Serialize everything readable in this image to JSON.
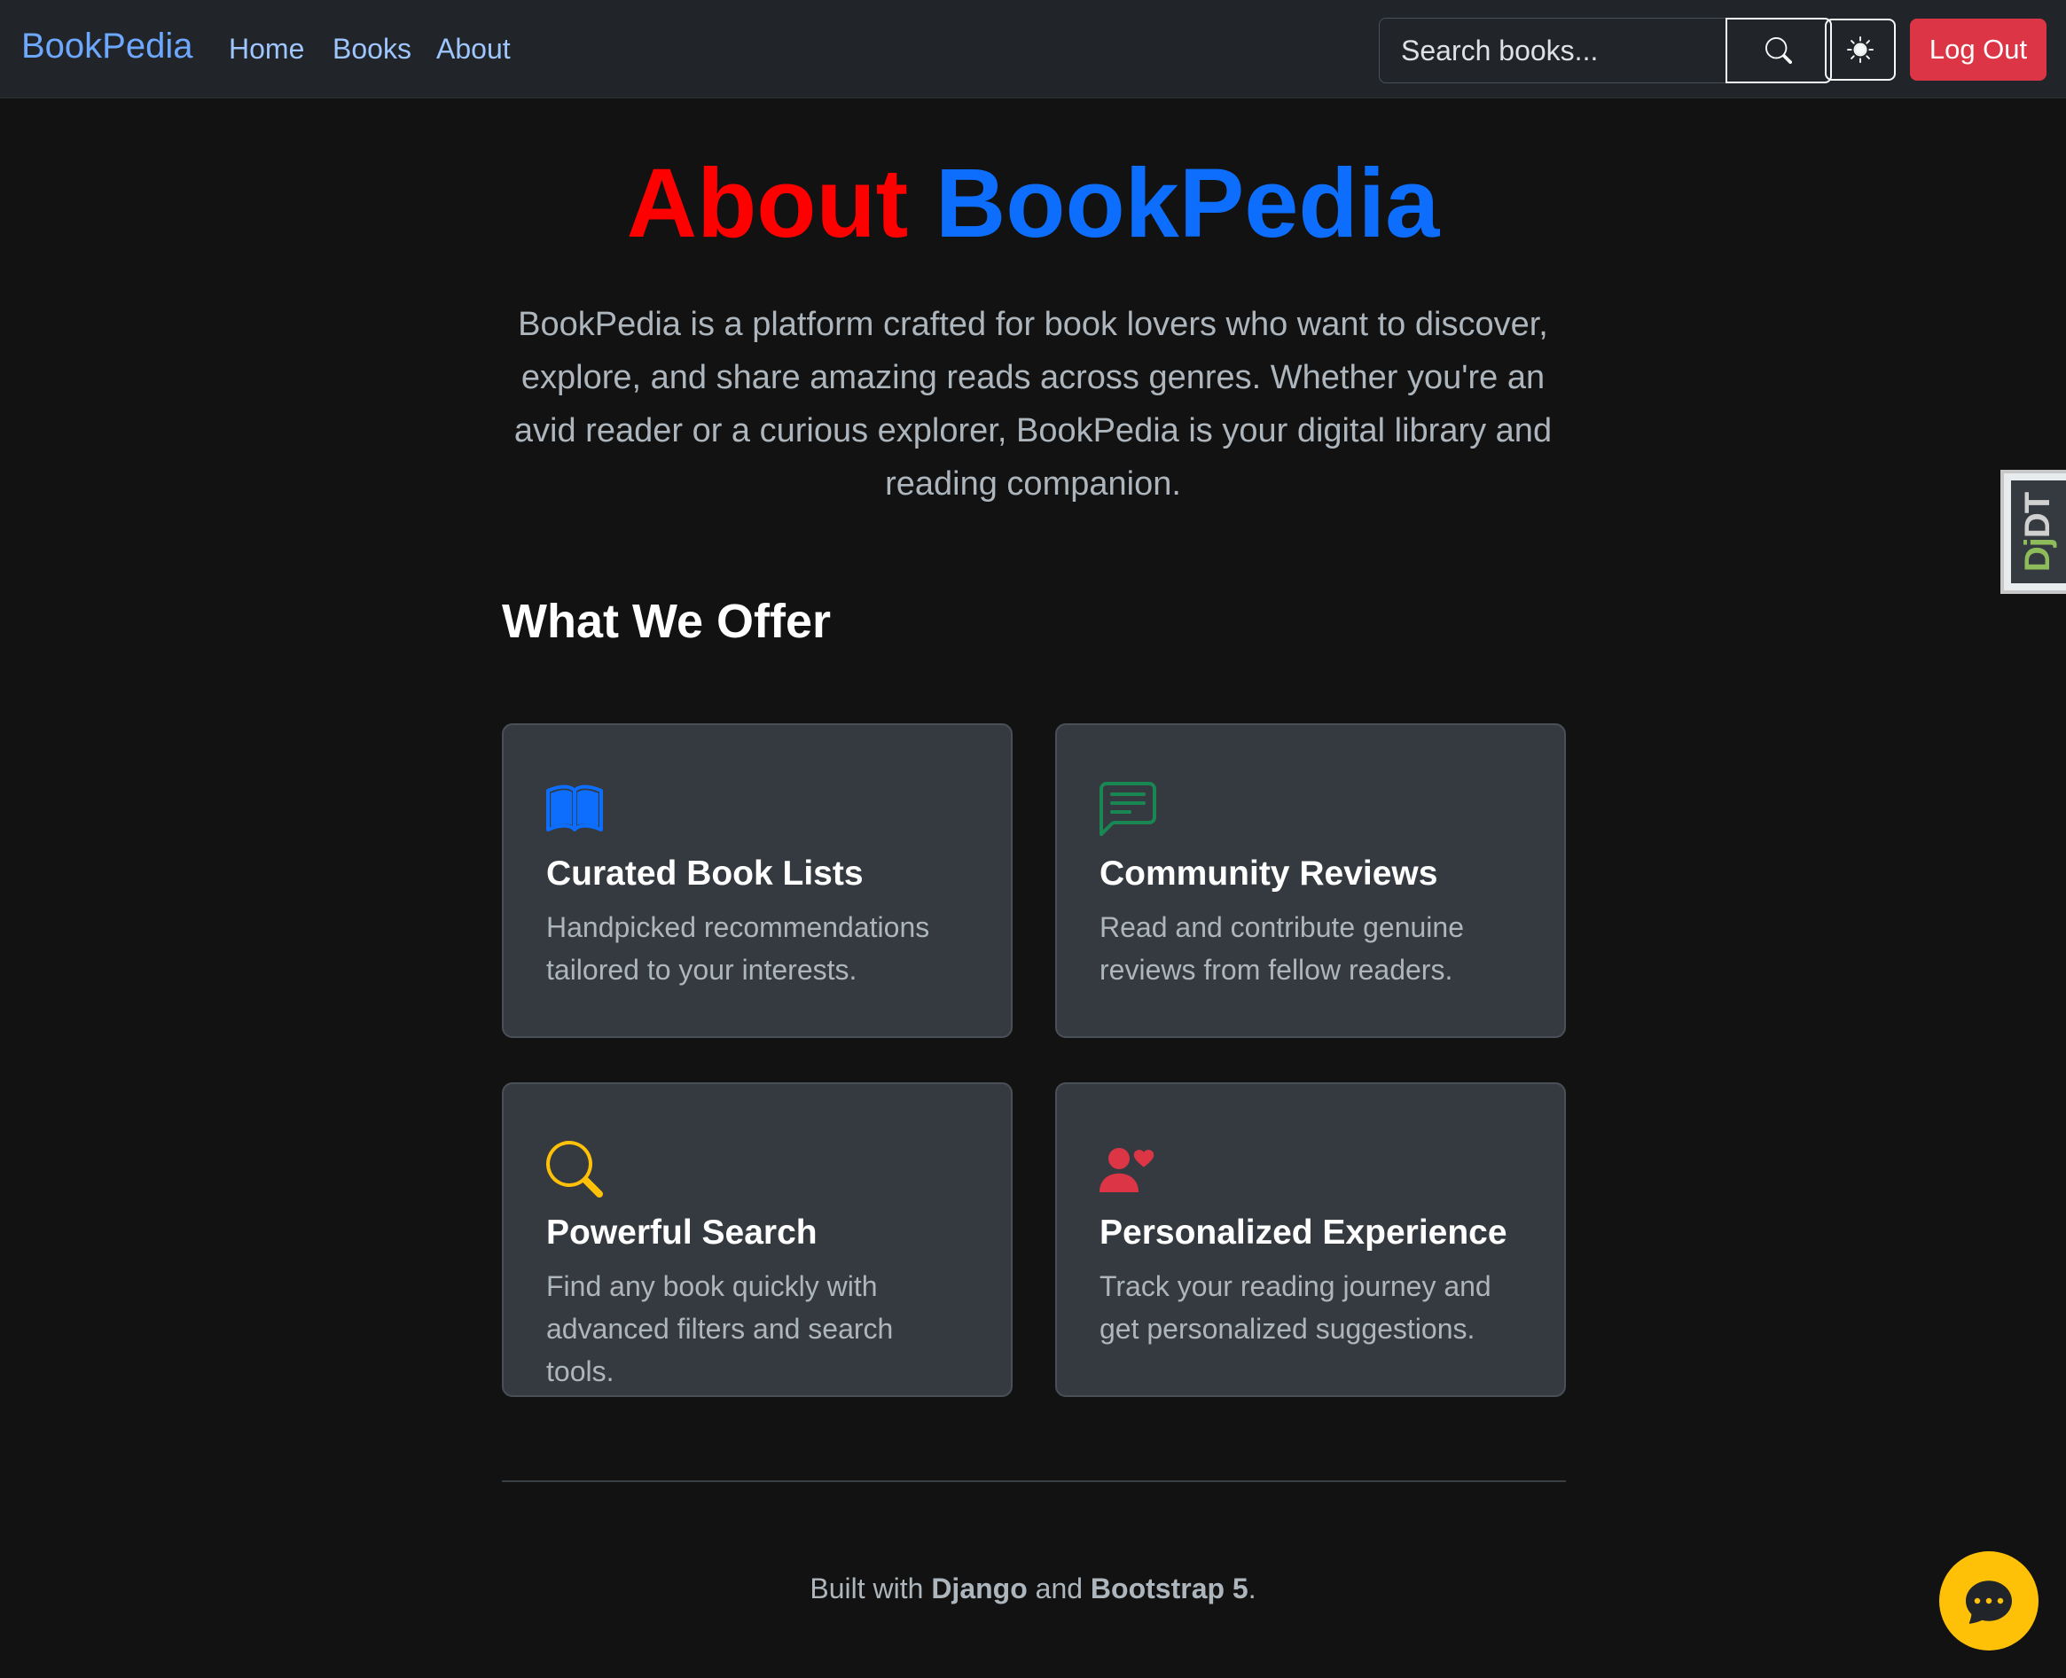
{
  "navbar": {
    "brand": "BookPedia",
    "links": [
      "Home",
      "Books",
      "About"
    ],
    "search_placeholder": "Search books...",
    "logout_label": "Log Out"
  },
  "hero": {
    "title_part1": "About",
    "title_part2": "BookPedia",
    "lead": "BookPedia is a platform crafted for book lovers who want to discover, explore, and share amazing reads across genres. Whether you're an avid reader or a curious explorer, BookPedia is your digital library and reading companion."
  },
  "offers": {
    "title": "What We Offer",
    "cards": [
      {
        "icon": "book-icon",
        "color": "#0d6efd",
        "title": "Curated Book Lists",
        "text": "Handpicked recommendations tailored to your interests."
      },
      {
        "icon": "chat-square-text-icon",
        "color": "#198754",
        "title": "Community Reviews",
        "text": "Read and contribute genuine reviews from fellow readers."
      },
      {
        "icon": "search-icon",
        "color": "#ffc107",
        "title": "Powerful Search",
        "text": "Find any book quickly with advanced filters and search tools."
      },
      {
        "icon": "person-heart-icon",
        "color": "#dc3545",
        "title": "Personalized Experience",
        "text": "Track your reading journey and get personalized suggestions."
      }
    ]
  },
  "footer": {
    "prefix": "Built with",
    "django": "Django",
    "and": "and",
    "bootstrap": "Bootstrap 5",
    "suffix": "."
  },
  "debug_toolbar": {
    "dj": "Dj",
    "dt": "DT"
  }
}
